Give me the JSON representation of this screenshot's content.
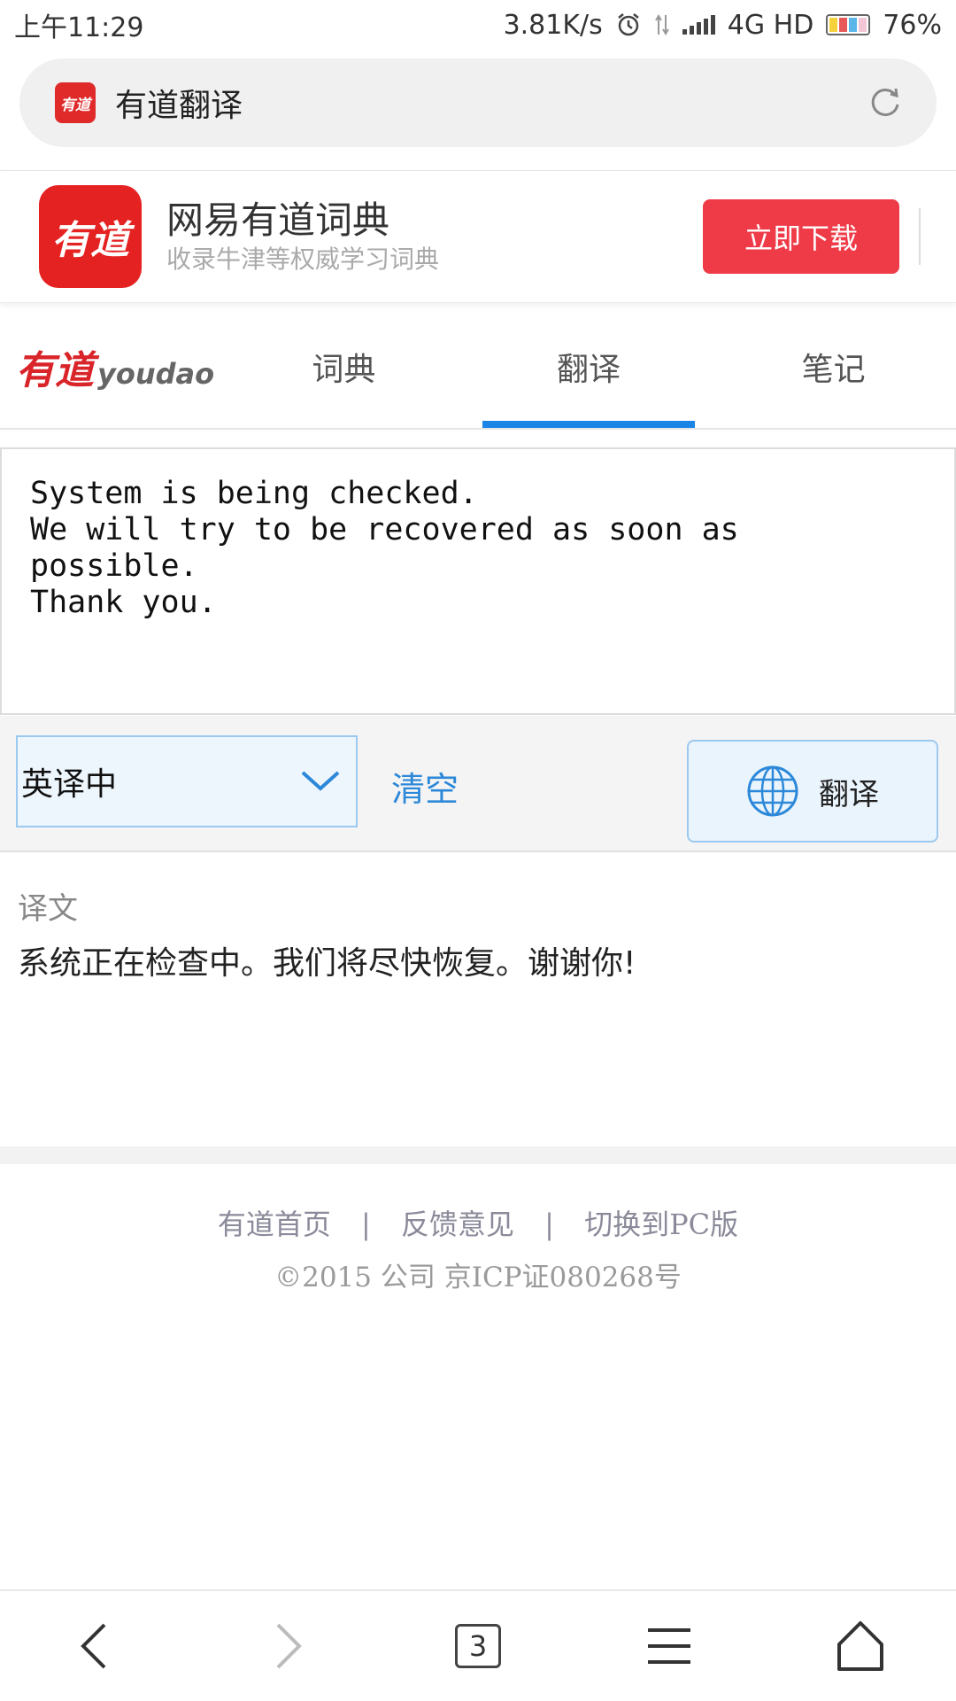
{
  "status_bar": {
    "time": "上午11:29",
    "speed": "3.81K/s",
    "network": "4G HD",
    "battery": "76%"
  },
  "url_bar": {
    "logo_text": "有道",
    "title": "有道翻译"
  },
  "banner": {
    "logo_text": "有道",
    "app_name": "网易有道词典",
    "subtitle": "收录牛津等权威学习词典",
    "download_label": "立即下载"
  },
  "nav": {
    "logo_cn": "有道",
    "logo_en": "youdao",
    "tabs": [
      {
        "label": "词典"
      },
      {
        "label": "翻译"
      },
      {
        "label": "笔记"
      }
    ],
    "active_tab": "翻译"
  },
  "input": {
    "value": "System is being checked.\nWe will try to be recovered as soon as\npossible.\nThank you."
  },
  "controls": {
    "language": "英译中",
    "clear_label": "清空",
    "translate_label": "翻译"
  },
  "result": {
    "label": "译文",
    "text": "系统正在检查中。我们将尽快恢复。谢谢你!"
  },
  "footer": {
    "links": [
      "有道首页",
      "反馈意见",
      "切换到PC版"
    ],
    "separator": "|",
    "copyright": "©2015 公司 京ICP证080268号"
  },
  "bottom_bar": {
    "tab_count": "3"
  },
  "colors": {
    "accent_blue": "#1a84e6",
    "brand_red": "#e52222",
    "download_red": "#ef3b48"
  }
}
